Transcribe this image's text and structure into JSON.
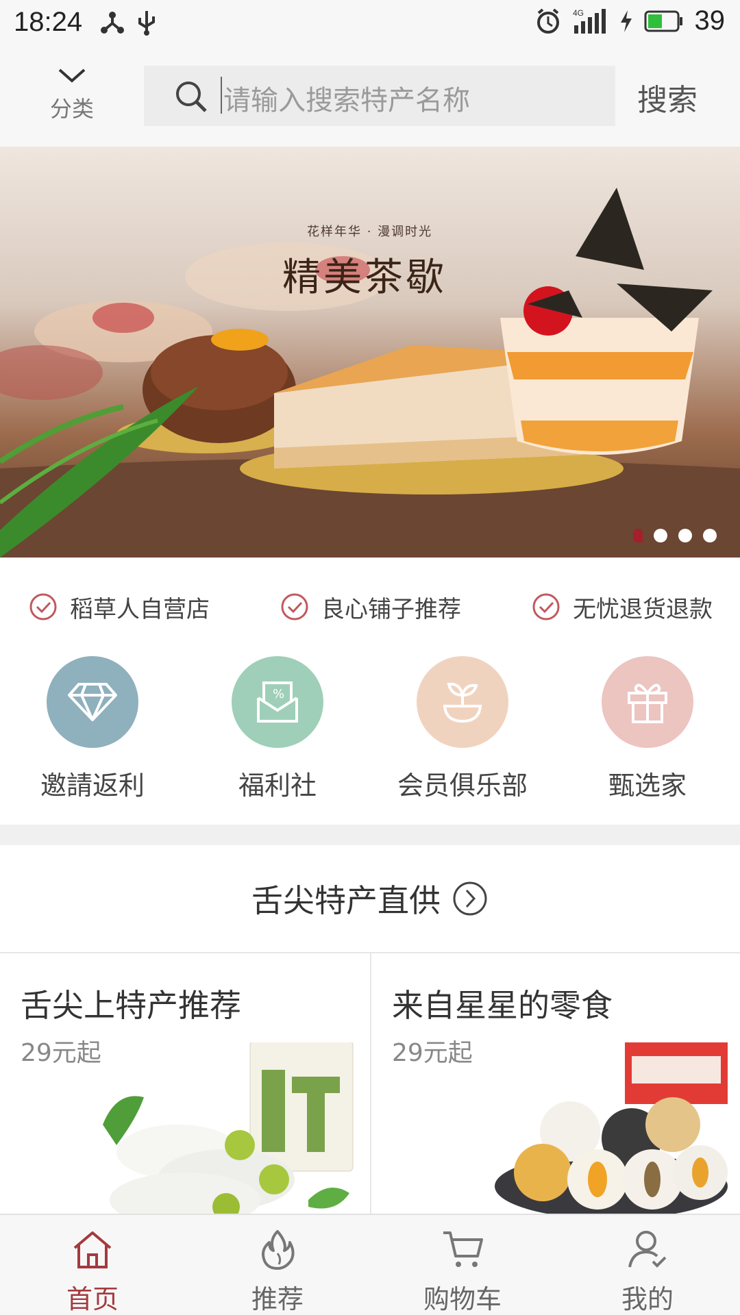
{
  "status_bar": {
    "time": "18:24",
    "network": "4G",
    "battery": "39",
    "icons": [
      "share-icon",
      "usb-icon",
      "alarm-icon",
      "signal-icon",
      "charging-icon",
      "battery-icon"
    ]
  },
  "header": {
    "category_label": "分类",
    "search_placeholder": "请输入搜索特产名称",
    "search_button": "搜索"
  },
  "banner": {
    "subtitle": "花样年华 · 漫调时光",
    "title": "精美茶歇",
    "slide_count": 4,
    "active_slide": 1
  },
  "guarantees": [
    {
      "label": "稻草人自营店",
      "icon": "check-circle-icon"
    },
    {
      "label": "良心铺子推荐",
      "icon": "check-circle-icon"
    },
    {
      "label": "无忧退货退款",
      "icon": "check-circle-icon"
    }
  ],
  "quick_nav": [
    {
      "label": "邀請返利",
      "icon": "diamond-icon",
      "color": "#8fb0bd"
    },
    {
      "label": "福利社",
      "icon": "coupon-envelope-icon",
      "color": "#9fcfb8"
    },
    {
      "label": "会员俱乐部",
      "icon": "sprout-icon",
      "color": "#f0d3bf"
    },
    {
      "label": "甄选家",
      "icon": "gift-icon",
      "color": "#ecc4c0"
    }
  ],
  "section": {
    "title": "舌尖特产直供"
  },
  "cards": [
    {
      "title": "舌尖上特产推荐",
      "price": "29元起"
    },
    {
      "title": "来自星星的零食",
      "price": "29元起"
    }
  ],
  "tabs": [
    {
      "label": "首页",
      "icon": "home-icon",
      "active": true
    },
    {
      "label": "推荐",
      "icon": "flame-icon",
      "active": false
    },
    {
      "label": "购物车",
      "icon": "cart-icon",
      "active": false
    },
    {
      "label": "我的",
      "icon": "user-check-icon",
      "active": false
    }
  ],
  "colors": {
    "accent": "#a33a3f",
    "check": "#c0595e"
  }
}
